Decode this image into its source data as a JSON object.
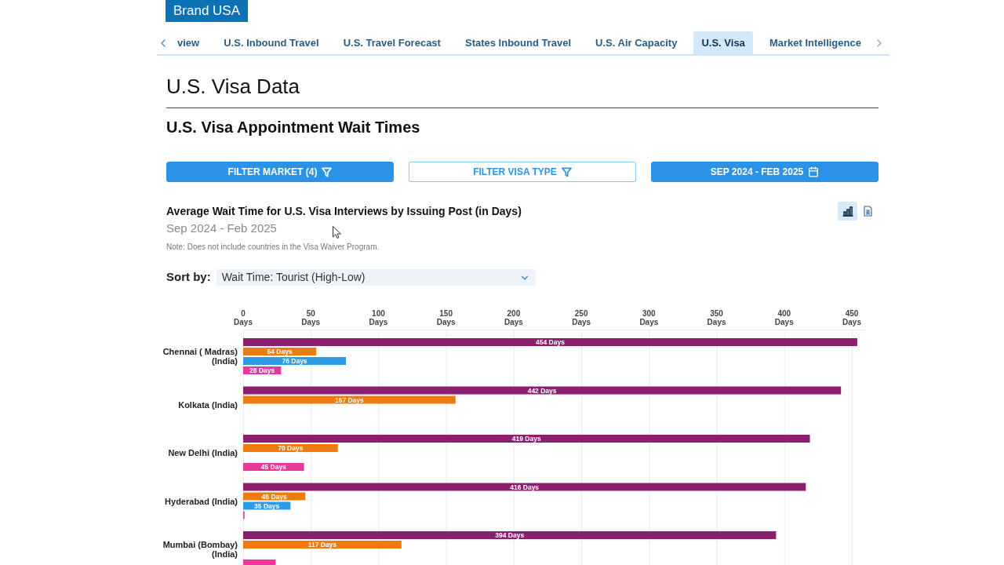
{
  "brand": {
    "label": "Brand USA"
  },
  "tabs": [
    {
      "label": "view",
      "selected": false
    },
    {
      "label": "U.S. Inbound Travel",
      "selected": false
    },
    {
      "label": "U.S. Travel Forecast",
      "selected": false
    },
    {
      "label": "States Inbound Travel",
      "selected": false
    },
    {
      "label": "U.S. Air Capacity",
      "selected": false
    },
    {
      "label": "U.S. Visa",
      "selected": true
    },
    {
      "label": "Market Intelligence",
      "selected": false
    }
  ],
  "page_title": "U.S. Visa Data",
  "section_title": "U.S. Visa Appointment Wait Times",
  "filters": [
    {
      "label": "FILTER MARKET (4)",
      "kind": "filter",
      "active": true
    },
    {
      "label": "FILTER VISA TYPE",
      "kind": "filter",
      "active": false
    },
    {
      "label": "SEP 2024 - FEB 2025",
      "kind": "date",
      "active": true
    }
  ],
  "chart_panel": {
    "title": "Average Wait Time for U.S. Visa Interviews by Issuing Post (in Days)",
    "subtitle": "Sep 2024 - Feb 2025",
    "note": "Note: Does not include countries in the Visa Waiver Program.",
    "view_toggle": [
      {
        "kind": "chart",
        "selected": true
      },
      {
        "kind": "table",
        "selected": false
      }
    ],
    "sort": {
      "label": "Sort by:",
      "value": "Wait Time: Tourist (High-Low)"
    },
    "chart_data": [
      {
        "type": "bar",
        "orientation": "horizontal",
        "categories": [
          "Chennai ( Madras) (India)",
          "Kolkata (India)",
          "New Delhi (India)",
          "Hyderabad (India)",
          "Mumbai (Bombay) (India)"
        ],
        "series": [
          {
            "color": "#8c1f70",
            "values": [
              454,
              442,
              419,
              416,
              394
            ],
            "value_labels": [
              "454 Days",
              "442 Days",
              "419 Days",
              "416 Days",
              "394 Days"
            ]
          },
          {
            "color": "#ef7a0d",
            "values": [
              54,
              157,
              70,
              46,
              117
            ],
            "value_labels": [
              "54 Days",
              "157 Days",
              "70 Days",
              "46 Days",
              "117 Days"
            ]
          },
          {
            "color": "#2d9be6",
            "values": [
              76,
              null,
              null,
              35,
              null
            ],
            "value_labels": [
              "76 Days",
              null,
              null,
              "35 Days",
              null
            ]
          },
          {
            "color": "#e8389c",
            "values": [
              28,
              null,
              45,
              1,
              24
            ],
            "value_labels": [
              "28 Days",
              null,
              "45 Days",
              null,
              null
            ]
          }
        ],
        "xlim": [
          0,
          460
        ],
        "xticks": [
          {
            "value": 0,
            "label": "0 Days"
          },
          {
            "value": 50,
            "label": "50 Days"
          },
          {
            "value": 100,
            "label": "100 Days"
          },
          {
            "value": 150,
            "label": "150 Days"
          },
          {
            "value": 200,
            "label": "200 Days"
          },
          {
            "value": 250,
            "label": "250 Days"
          },
          {
            "value": 300,
            "label": "300 Days"
          },
          {
            "value": 350,
            "label": "350 Days"
          },
          {
            "value": 400,
            "label": "400 Days"
          },
          {
            "value": 450,
            "label": "450 Days"
          }
        ],
        "grid": true,
        "data_labels": true
      }
    ]
  }
}
